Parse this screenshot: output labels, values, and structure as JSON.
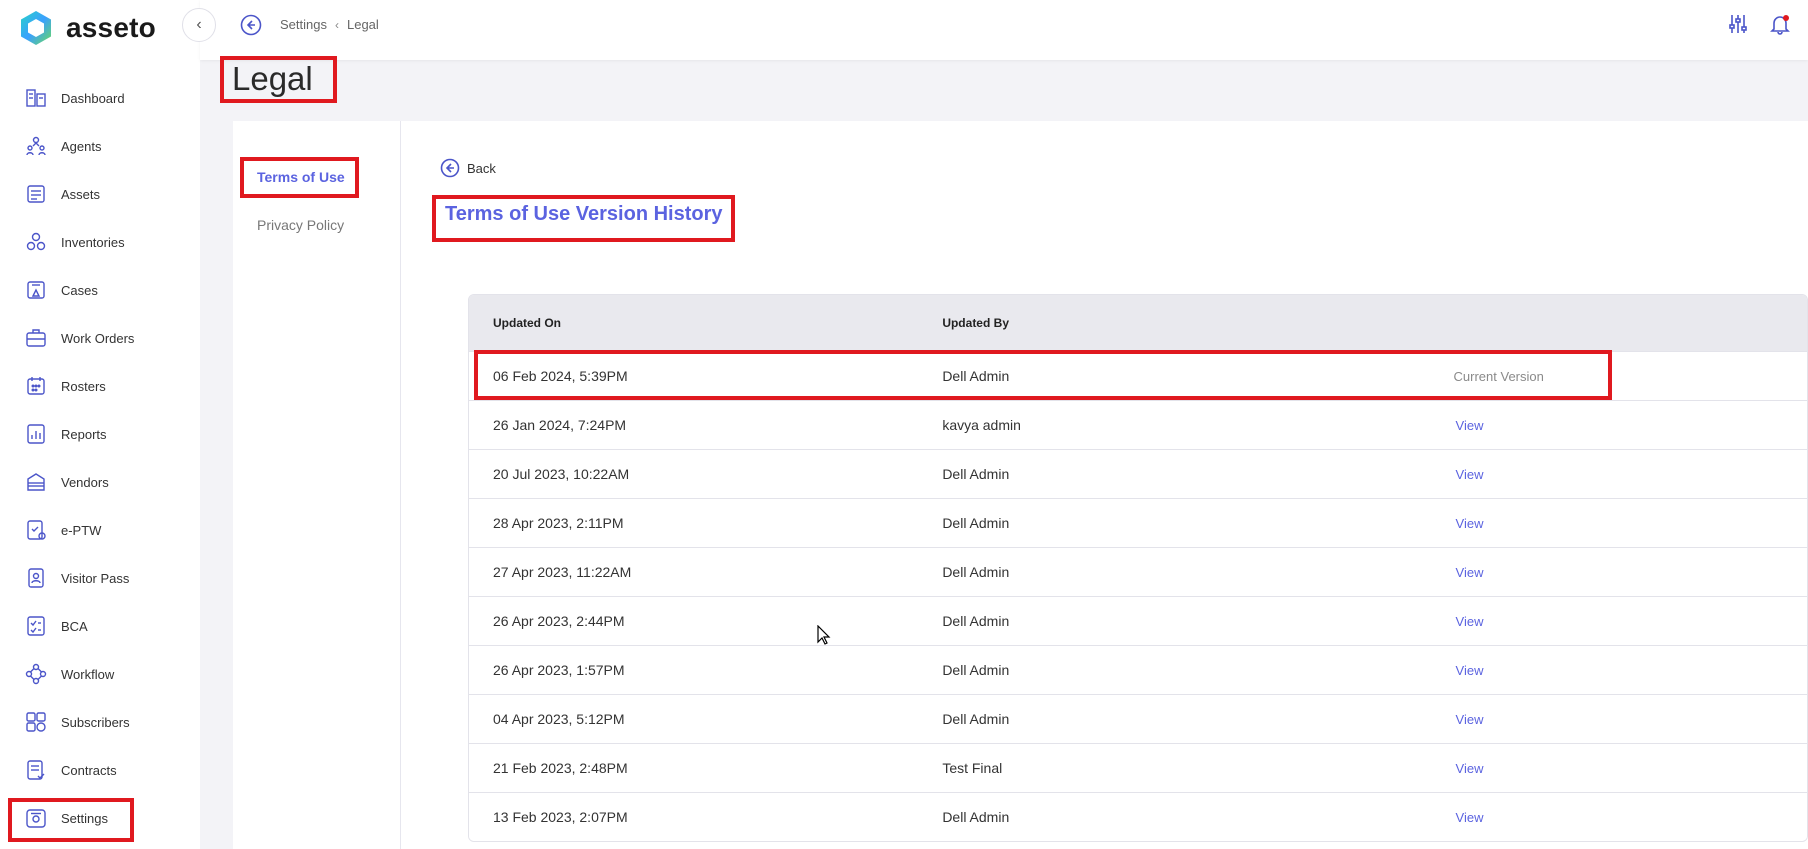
{
  "app": {
    "name": "asseto"
  },
  "sidebar": {
    "items": [
      {
        "label": "Dashboard",
        "icon": "dashboard-icon"
      },
      {
        "label": "Agents",
        "icon": "agents-icon"
      },
      {
        "label": "Assets",
        "icon": "assets-icon"
      },
      {
        "label": "Inventories",
        "icon": "inventories-icon"
      },
      {
        "label": "Cases",
        "icon": "cases-icon"
      },
      {
        "label": "Work Orders",
        "icon": "work-orders-icon"
      },
      {
        "label": "Rosters",
        "icon": "rosters-icon"
      },
      {
        "label": "Reports",
        "icon": "reports-icon"
      },
      {
        "label": "Vendors",
        "icon": "vendors-icon"
      },
      {
        "label": "e-PTW",
        "icon": "eptw-icon"
      },
      {
        "label": "Visitor Pass",
        "icon": "visitor-pass-icon"
      },
      {
        "label": "BCA",
        "icon": "bca-icon"
      },
      {
        "label": "Workflow",
        "icon": "workflow-icon"
      },
      {
        "label": "Subscribers",
        "icon": "subscribers-icon"
      },
      {
        "label": "Contracts",
        "icon": "contracts-icon"
      },
      {
        "label": "Settings",
        "icon": "settings-icon"
      }
    ]
  },
  "breadcrumb": {
    "parent": "Settings",
    "current": "Legal"
  },
  "page": {
    "title": "Legal"
  },
  "subnav": {
    "terms": "Terms of Use",
    "privacy": "Privacy Policy"
  },
  "content": {
    "back_label": "Back",
    "section_title": "Terms of Use Version History"
  },
  "table": {
    "headers": {
      "updated_on": "Updated On",
      "updated_by": "Updated By"
    },
    "rows": [
      {
        "updated_on": "06 Feb 2024, 5:39PM",
        "updated_by": "Dell Admin",
        "action": "Current Version"
      },
      {
        "updated_on": "26 Jan 2024, 7:24PM",
        "updated_by": "kavya admin",
        "action": "View"
      },
      {
        "updated_on": "20 Jul 2023, 10:22AM",
        "updated_by": "Dell Admin",
        "action": "View"
      },
      {
        "updated_on": "28 Apr 2023, 2:11PM",
        "updated_by": "Dell Admin",
        "action": "View"
      },
      {
        "updated_on": "27 Apr 2023, 11:22AM",
        "updated_by": "Dell Admin",
        "action": "View"
      },
      {
        "updated_on": "26 Apr 2023, 2:44PM",
        "updated_by": "Dell Admin",
        "action": "View"
      },
      {
        "updated_on": "26 Apr 2023, 1:57PM",
        "updated_by": "Dell Admin",
        "action": "View"
      },
      {
        "updated_on": "04 Apr 2023, 5:12PM",
        "updated_by": "Dell Admin",
        "action": "View"
      },
      {
        "updated_on": "21 Feb 2023, 2:48PM",
        "updated_by": "Test Final",
        "action": "View"
      },
      {
        "updated_on": "13 Feb 2023, 2:07PM",
        "updated_by": "Dell Admin",
        "action": "View"
      }
    ]
  },
  "colors": {
    "accent": "#5b63e0",
    "highlight": "#e0191f"
  }
}
